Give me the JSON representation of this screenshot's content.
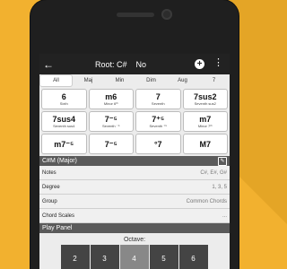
{
  "appbar": {
    "title": "Root: C#",
    "subtitle": "No",
    "back_icon": "arrow-left-icon",
    "add_icon": "plus-circle-icon",
    "more_icon": "vertical-dots-icon"
  },
  "tabs": [
    "All",
    "Maj",
    "Min",
    "Dim",
    "Aug",
    "7"
  ],
  "chords": [
    {
      "sym": "6",
      "name": "Sixth"
    },
    {
      "sym": "m6",
      "name": "Minor 6ᵗʰ"
    },
    {
      "sym": "7",
      "name": "Seventh"
    },
    {
      "sym": "7sus2",
      "name": "Seventh sus2"
    },
    {
      "sym": "7sus4",
      "name": "Seventh sus4"
    },
    {
      "sym": "7⁻⁵",
      "name": "Seventh ⁻⁵"
    },
    {
      "sym": "7⁺⁵",
      "name": "Seventh ⁺⁵"
    },
    {
      "sym": "m7",
      "name": "Minor 7ᵗʰ"
    },
    {
      "sym": "m7⁻⁵",
      "name": ""
    },
    {
      "sym": "7⁻⁵",
      "name": ""
    },
    {
      "sym": "°7",
      "name": ""
    },
    {
      "sym": "M7",
      "name": ""
    }
  ],
  "details": {
    "header": "C#M (Major)",
    "notes_label": "Notes",
    "notes_value": "C#, E#, G#",
    "degree_label": "Degree",
    "degree_value": "1, 3, 5",
    "group_label": "Group",
    "group_value": "Common Chords",
    "scales_label": "Chord Scales",
    "scales_value": "..."
  },
  "play": {
    "header": "Play Panel",
    "octave_label": "Octave:",
    "octaves": [
      "2",
      "3",
      "4",
      "5",
      "6"
    ],
    "selected": "4"
  },
  "colors": {
    "background": "#F2B12F",
    "appbar": "#222222",
    "section_header": "#5A5A5A"
  }
}
